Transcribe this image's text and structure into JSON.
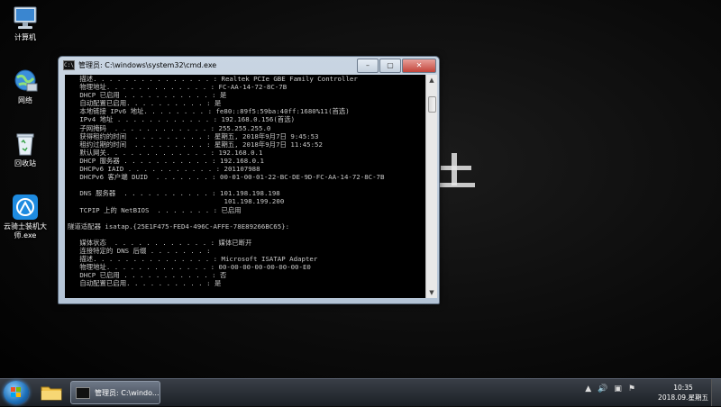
{
  "desktop": {
    "icons": [
      {
        "label": "计算机",
        "icon": "computer-icon"
      },
      {
        "label": "网络",
        "icon": "network-icon"
      },
      {
        "label": "回收站",
        "icon": "recycle-bin-icon"
      },
      {
        "label": "云骑士装机大师.exe",
        "icon": "yunqishi-icon"
      }
    ]
  },
  "window": {
    "title": "管理员: C:\\windows\\system32\\cmd.exe",
    "lines": [
      "   描述. . . . . . . . . . . . . . . : Realtek PCIe GBE Family Controller",
      "   物理地址. . . . . . . . . . . . . : FC-AA-14-72-8C-7B",
      "   DHCP 已启用 . . . . . . . . . . . : 是",
      "   自动配置已启用. . . . . . . . . . : 是",
      "   本地链接 IPv6 地址. . . . . . . . : fe80::89f5:59ba:40ff:1680%11(首选)",
      "   IPv4 地址 . . . . . . . . . . . . : 192.168.0.156(首选)",
      "   子网掩码  . . . . . . . . . . . . : 255.255.255.0",
      "   获得租约的时间  . . . . . . . . . : 星期五, 2018年9月7日 9:45:53",
      "   租约过期的时间  . . . . . . . . . : 星期五, 2018年9月7日 11:45:52",
      "   默认网关. . . . . . . . . . . . . : 192.168.0.1",
      "   DHCP 服务器 . . . . . . . . . . . : 192.168.0.1",
      "   DHCPv6 IAID . . . . . . . . . . . : 201107988",
      "   DHCPv6 客户端 DUID  . . . . . . . : 00-01-00-01-22-BC-DE-9D-FC-AA-14-72-8C-7B",
      "",
      "   DNS 服务器  . . . . . . . . . . . : 101.198.198.198",
      "                                       101.198.199.200",
      "   TCPIP 上的 NetBIOS  . . . . . . . : 已启用",
      "",
      "隧道适配器 isatap.{25E1F475-FED4-496C-AFFE-78E89266BC65}:",
      "",
      "   媒体状态  . . . . . . . . . . . . : 媒体已断开",
      "   连接特定的 DNS 后缀 . . . . . . . :",
      "   描述. . . . . . . . . . . . . . . : Microsoft ISATAP Adapter",
      "   物理地址. . . . . . . . . . . . . : 00-00-00-00-00-00-00-E0",
      "   DHCP 已启用 . . . . . . . . . . . : 否",
      "   自动配置已启用. . . . . . . . . . : 是"
    ]
  },
  "taskbar": {
    "task_label": "管理员: C:\\windo...",
    "clock_time": "10:35",
    "clock_date": "2018.09.星期五"
  },
  "colors": {
    "console_bg": "#000000",
    "console_text": "#c8c8c8",
    "taskbar": "#2a2f36"
  }
}
